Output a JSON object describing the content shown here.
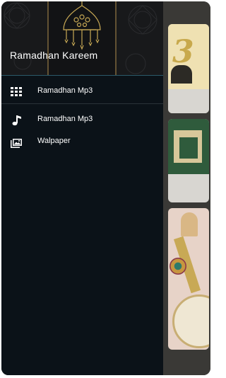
{
  "drawer": {
    "title": "Ramadhan Kareem",
    "items": [
      {
        "label": "Ramadhan Mp3",
        "icon": "grid-icon"
      },
      {
        "label": "Ramadhan Mp3",
        "icon": "music-note-icon"
      },
      {
        "label": "Walpaper",
        "icon": "wallpaper-icon"
      }
    ]
  },
  "colors": {
    "drawer_background": "#0b1218",
    "header_background": "#17181a",
    "accent_gold": "#c8a955"
  }
}
